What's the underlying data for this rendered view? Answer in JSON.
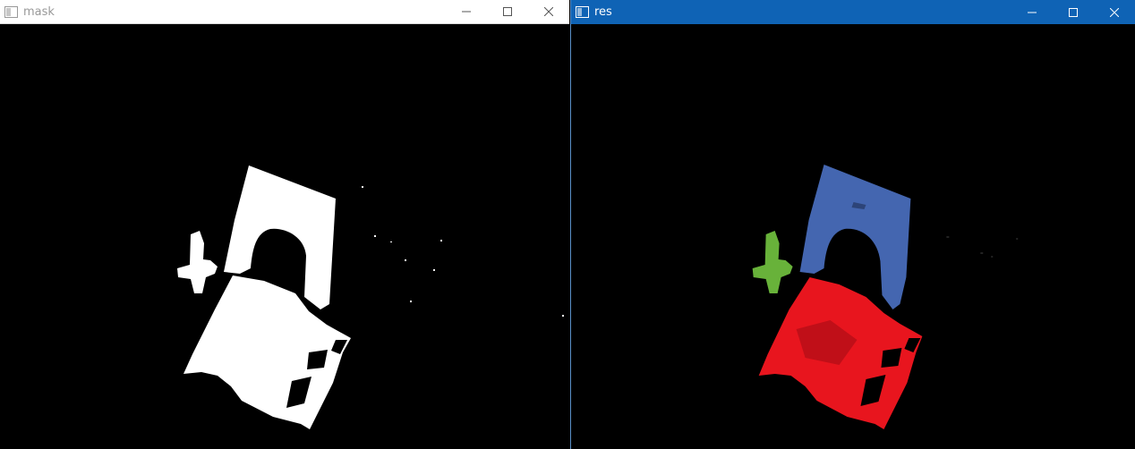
{
  "windows": {
    "mask": {
      "title": "mask",
      "titlebar_color": "#ffffff",
      "title_color": "#999999",
      "icons": [
        "app-icon",
        "minimize-icon",
        "maximize-icon",
        "close-icon"
      ]
    },
    "res": {
      "title": "res",
      "titlebar_color": "#0f63b5",
      "title_color": "#ffffff",
      "icons": [
        "app-icon",
        "minimize-icon",
        "maximize-icon",
        "close-icon"
      ]
    }
  },
  "objects": {
    "blue_object_color": "#4466b0",
    "red_object_color": "#e8151e",
    "green_object_color": "#68b23a",
    "mask_color": "#ffffff",
    "background_color": "#000000"
  }
}
